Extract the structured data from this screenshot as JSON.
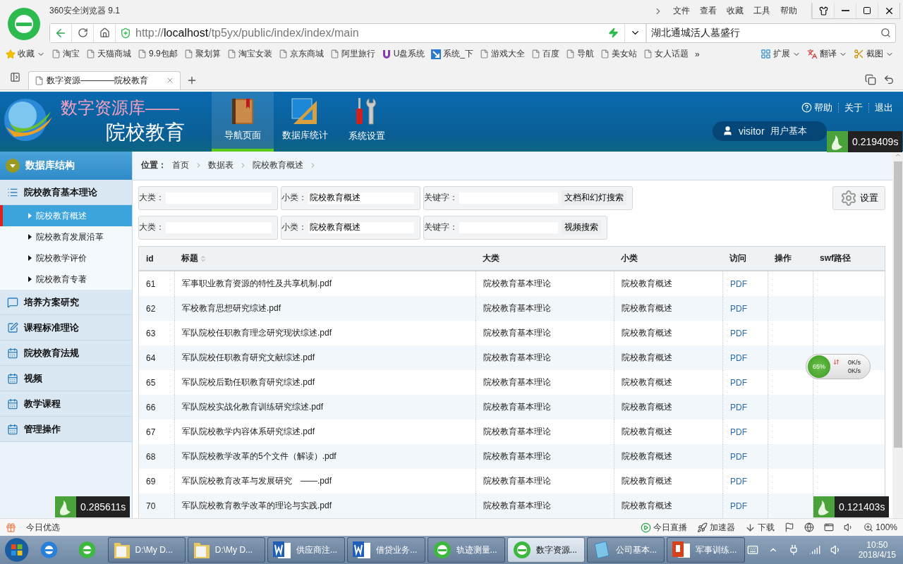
{
  "browser": {
    "title": "360安全浏览器 9.1",
    "menu": [
      "文件",
      "查看",
      "收藏",
      "工具",
      "帮助"
    ],
    "url": "http://**localhost**/tp5yx/public/index/index/main",
    "search": {
      "value": "湖北通城活人墓盛行"
    },
    "bookmarks": [
      {
        "label": "收藏",
        "kind": "star"
      },
      {
        "label": "淘宝",
        "kind": "page"
      },
      {
        "label": "天猫商城",
        "kind": "page"
      },
      {
        "label": "9.9包邮",
        "kind": "page"
      },
      {
        "label": "聚划算",
        "kind": "page"
      },
      {
        "label": "淘宝女装",
        "kind": "page"
      },
      {
        "label": "京东商城",
        "kind": "page"
      },
      {
        "label": "阿里旅行",
        "kind": "page"
      },
      {
        "label": "U盘系统",
        "kind": "u"
      },
      {
        "label": "系统_下",
        "kind": "arrow"
      },
      {
        "label": "游戏大全",
        "kind": "page"
      },
      {
        "label": "百度",
        "kind": "page"
      },
      {
        "label": "导航",
        "kind": "page"
      },
      {
        "label": "美女站",
        "kind": "page"
      },
      {
        "label": "女人话题",
        "kind": "page"
      }
    ],
    "more": "»",
    "tools": [
      {
        "label": "扩展",
        "kind": "ext"
      },
      {
        "label": "翻译",
        "kind": "translate"
      },
      {
        "label": "截图",
        "kind": "shot"
      }
    ],
    "tab": {
      "title": "数字资源————院校教育"
    }
  },
  "header": {
    "title_line1": "数字资源库——",
    "title_line2": "院校教育",
    "nav": [
      {
        "label": "导航页面",
        "kind": "book",
        "selected": true
      },
      {
        "label": "数据库统计",
        "kind": "ruler",
        "selected": false
      },
      {
        "label": "系统设置",
        "kind": "tools",
        "selected": false
      }
    ],
    "links": [
      "帮助",
      "关于",
      "退出"
    ],
    "user": "visitor",
    "user_info": "用户基本"
  },
  "sidebar": {
    "title": "数据库结构",
    "groups": [
      {
        "label": "院校教育基本理论",
        "kind": "list",
        "children": [
          {
            "label": "院校教育概述",
            "selected": true
          },
          {
            "label": "院校教育发展沿革",
            "selected": false
          },
          {
            "label": "院校教学评价",
            "selected": false
          },
          {
            "label": "院校教育专著",
            "selected": false
          }
        ]
      },
      {
        "label": "培养方案研究",
        "kind": "chat"
      },
      {
        "label": "课程标准理论",
        "kind": "edit"
      },
      {
        "label": "院校教育法规",
        "kind": "calendar"
      },
      {
        "label": "视频",
        "kind": "calendar"
      },
      {
        "label": "教学课程",
        "kind": "calendar"
      },
      {
        "label": "管理操作",
        "kind": "calendar"
      }
    ]
  },
  "breadcrumb": {
    "label": "位置：",
    "items": [
      "首页",
      "数据表",
      "院校教育概述"
    ]
  },
  "search_rows": [
    {
      "category_label": "大类：",
      "subcategory_label": "小类：",
      "subcategory_value": "院校教育概述",
      "keyword_label": "关键字：",
      "button": "文档和幻灯搜索"
    },
    {
      "category_label": "大类：",
      "subcategory_label": "小类：",
      "subcategory_value": "院校教育概述",
      "keyword_label": "关键字：",
      "button": "视频搜索"
    }
  ],
  "settings_button": "设置",
  "table": {
    "columns": [
      "id",
      "标题",
      "大类",
      "小类",
      "访问",
      "操作",
      "swf路径"
    ],
    "rows": [
      [
        "61",
        "军事职业教育资源的特性及共享机制.pdf",
        "院校教育基本理论",
        "院校教育概述",
        "PDF"
      ],
      [
        "62",
        "军校教育思想研究综述.pdf",
        "院校教育基本理论",
        "院校教育概述",
        "PDF"
      ],
      [
        "63",
        "军队院校任职教育理念研究现状综述.pdf",
        "院校教育基本理论",
        "院校教育概述",
        "PDF"
      ],
      [
        "64",
        "军队院校任职教育研究文献综述.pdf",
        "院校教育基本理论",
        "院校教育概述",
        "PDF"
      ],
      [
        "65",
        "军队院校后勤任职教育研究综述.pdf",
        "院校教育基本理论",
        "院校教育概述",
        "PDF"
      ],
      [
        "66",
        "军队院校实战化教育训练研究综述.pdf",
        "院校教育基本理论",
        "院校教育概述",
        "PDF"
      ],
      [
        "67",
        "军队院校教学内容体系研究综述.pdf",
        "院校教育基本理论",
        "院校教育概述",
        "PDF"
      ],
      [
        "68",
        "军队院校教学改革的5个文件（解读）.pdf",
        "院校教育基本理论",
        "院校教育概述",
        "PDF"
      ],
      [
        "69",
        "军队院校教育改革与发展研究　——.pdf",
        "院校教育基本理论",
        "院校教育概述",
        "PDF"
      ],
      [
        "70",
        "军队院校教育教学改革的理论与实践.pdf",
        "院校教育基本理论",
        "院校教育概述",
        "PDF"
      ]
    ]
  },
  "timers": [
    "0.219409s",
    "0.285611s",
    "0.121403s"
  ],
  "speed_widget": {
    "percent": "65%",
    "up": "0K/s",
    "down": "0K/s"
  },
  "status_bar": {
    "left": "今日优选",
    "items": [
      {
        "label": "今日直播",
        "kind": "play"
      },
      {
        "label": "加速器",
        "kind": "rocket"
      },
      {
        "label": "下载",
        "kind": "download"
      }
    ],
    "zoom": "100%"
  },
  "taskbar": {
    "items": [
      {
        "label": "D:\\My D...",
        "kind": "folder",
        "selected": false
      },
      {
        "label": "D:\\My D...",
        "kind": "folder",
        "selected": false
      },
      {
        "label": "供应商注...",
        "kind": "word",
        "selected": false
      },
      {
        "label": "借贷业务...",
        "kind": "word",
        "selected": false
      },
      {
        "label": "轨迹测量...",
        "kind": "browser",
        "selected": false
      },
      {
        "label": "数字资源...",
        "kind": "browser",
        "selected": true
      },
      {
        "label": "公司基本...",
        "kind": "notepad",
        "selected": false
      },
      {
        "label": "军事训练...",
        "kind": "ppt",
        "selected": false
      }
    ],
    "time": "10:50",
    "date": "2018/4/15"
  }
}
